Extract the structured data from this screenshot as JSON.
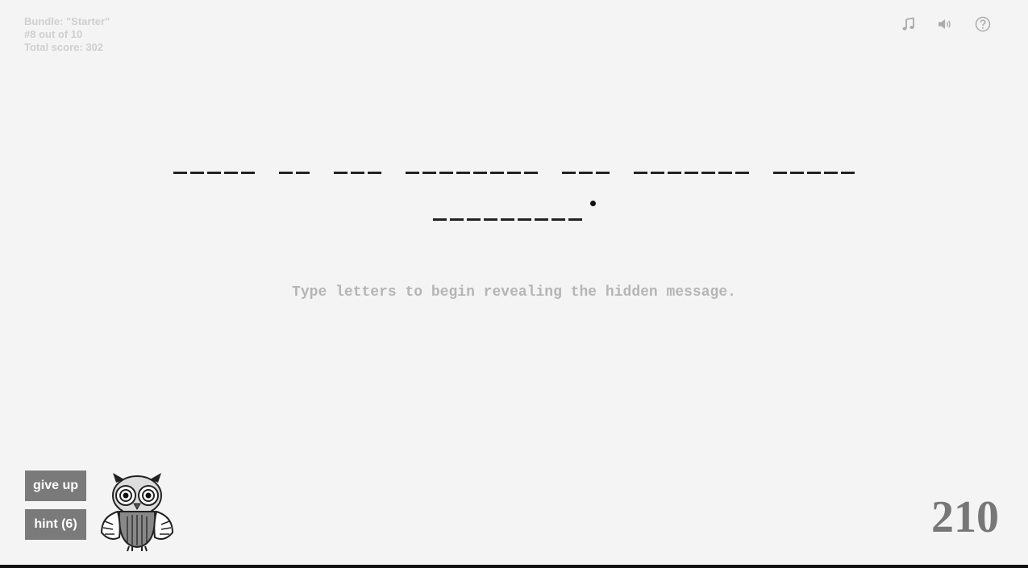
{
  "stats": {
    "bundle": "Bundle: \"Starter\"",
    "progress": "#8 out of 10",
    "total_score": "Total score: 302"
  },
  "top_icons": [
    "music-note-icon",
    "speaker-icon",
    "help-icon"
  ],
  "puzzle": {
    "lines": [
      [
        5,
        2,
        3,
        8,
        3,
        7,
        5
      ],
      [
        9
      ]
    ],
    "final_punctuation": "."
  },
  "message": "Type letters to begin revealing the hidden message.",
  "buttons": {
    "give_up": "give up",
    "hint": "hint (6)"
  },
  "score": "210",
  "colors": {
    "background": "#f4f4f4",
    "button": "#7a7a7a",
    "score": "#777777",
    "stats": "#cfcfcf"
  }
}
